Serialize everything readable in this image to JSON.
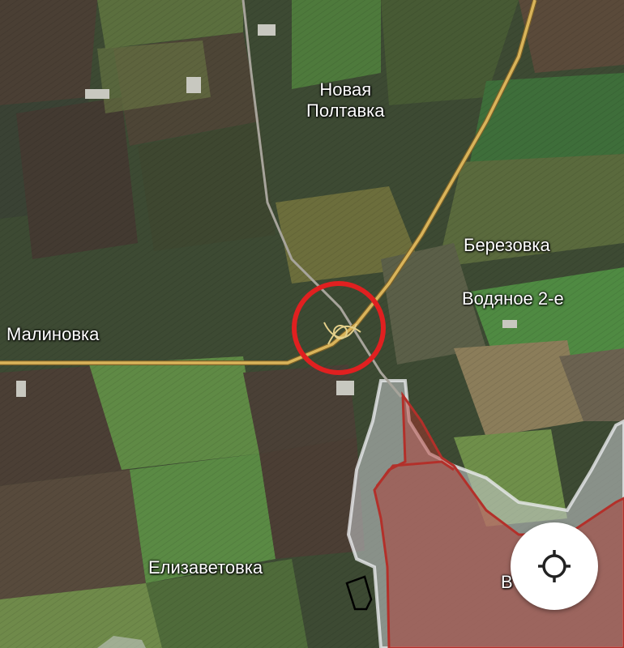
{
  "map": {
    "places": {
      "novaya_poltavka": "Новая\nПолтавка",
      "berezovka": "Березовка",
      "vodyanoe": "Водяное 2-е",
      "malinovka": "Малиновка",
      "elizavetovka": "Елизаветовка",
      "partial_town": "В      ненка"
    },
    "colors": {
      "road": "#d9b45a",
      "highlight_circle": "#e02020",
      "controlled_zone_outline": "#b3302a",
      "contested_zone_fill": "#c9ccd0"
    }
  },
  "controls": {
    "locate_icon": "crosshair-target-icon"
  }
}
